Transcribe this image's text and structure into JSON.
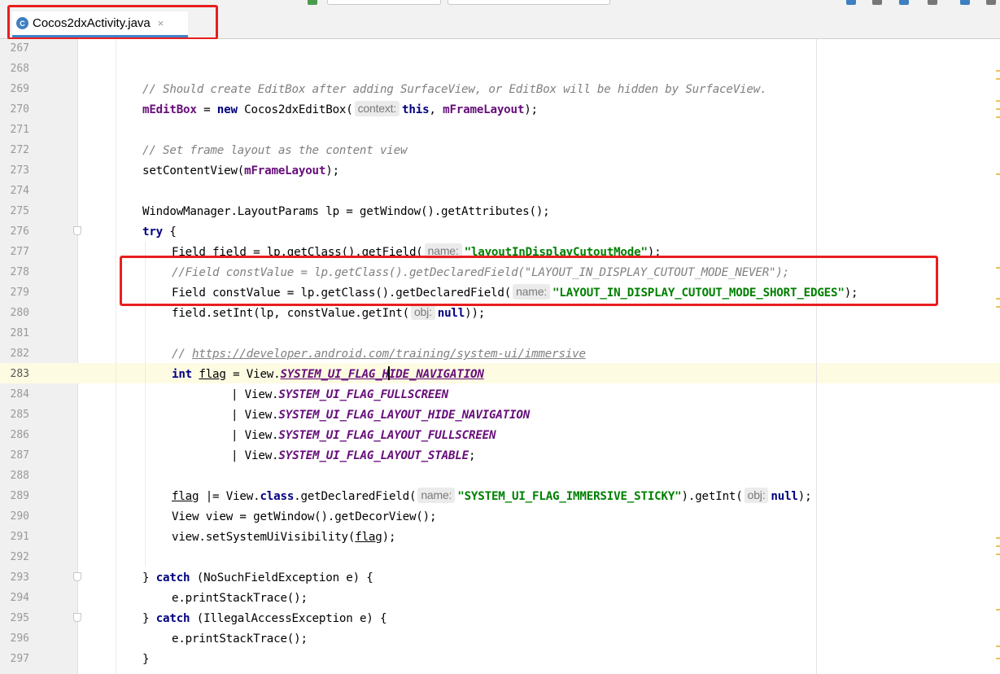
{
  "tab": {
    "label": "Cocos2dxActivity.java",
    "icon_letter": "C",
    "close_glyph": "×",
    "icon": "java-class-icon"
  },
  "hints": {
    "context": "context:",
    "name": "name:",
    "obj": "obj:"
  },
  "line_numbers": [
    "267",
    "268",
    "269",
    "270",
    "271",
    "272",
    "273",
    "274",
    "275",
    "276",
    "277",
    "278",
    "279",
    "280",
    "281",
    "282",
    "283",
    "284",
    "285",
    "286",
    "287",
    "288",
    "289",
    "290",
    "291",
    "292",
    "293",
    "294",
    "295",
    "296",
    "297"
  ],
  "code": {
    "l269_comment": "// Should create EditBox after adding SurfaceView, or EditBox will be hidden by SurfaceView.",
    "l270_var": "mEditBox",
    "l270_a": " = ",
    "l270_new": "new",
    "l270_b": " Cocos2dxEditBox(",
    "l270_this": "this",
    "l270_c": ", ",
    "l270_arg": "mFrameLayout",
    "l270_d": ");",
    "l272_comment": "// Set frame layout as the content view",
    "l273_a": "setContentView(",
    "l273_arg": "mFrameLayout",
    "l273_b": ");",
    "l275": "WindowManager.LayoutParams lp = getWindow().getAttributes();",
    "l276_try": "try",
    "l276_b": " {",
    "l277_a": "Field field = lp.getClass().getField(",
    "l277_str": "\"layoutInDisplayCutoutMode\"",
    "l277_b": ");",
    "l278_comment": "//Field constValue = lp.getClass().getDeclaredField(\"LAYOUT_IN_DISPLAY_CUTOUT_MODE_NEVER\");",
    "l279_a": "Field constValue = lp.getClass().getDeclaredField(",
    "l279_str": "\"LAYOUT_IN_DISPLAY_CUTOUT_MODE_SHORT_EDGES\"",
    "l279_b": ");",
    "l280_a": "field.setInt(lp, constValue.getInt(",
    "l280_null": "null",
    "l280_b": "));",
    "l282_comment": "// ",
    "l282_link": "https://developer.android.com/training/system-ui/immersive",
    "l283_int": "int",
    "l283_var": "flag",
    "l283_a": " = View.",
    "l283_fld_a": "SYSTEM_UI_FLAG_H",
    "l283_fld_b": "IDE_NAVIGATION",
    "l284_a": "| View.",
    "l284_fld": "SYSTEM_UI_FLAG_FULLSCREEN",
    "l285_a": "| View.",
    "l285_fld": "SYSTEM_UI_FLAG_LAYOUT_HIDE_NAVIGATION",
    "l286_a": "| View.",
    "l286_fld": "SYSTEM_UI_FLAG_LAYOUT_FULLSCREEN",
    "l287_a": "| View.",
    "l287_fld": "SYSTEM_UI_FLAG_LAYOUT_STABLE",
    "l287_b": ";",
    "l289_var": "flag",
    "l289_a": " |= View.",
    "l289_class": "class",
    "l289_b": ".getDeclaredField(",
    "l289_str": "\"SYSTEM_UI_FLAG_IMMERSIVE_STICKY\"",
    "l289_c": ").getInt(",
    "l289_null": "null",
    "l289_d": ");",
    "l290": "View view = getWindow().getDecorView();",
    "l291_a": "view.setSystemUiVisibility(",
    "l291_var": "flag",
    "l291_b": ");",
    "l293_a": "} ",
    "l293_catch": "catch",
    "l293_b": " (NoSuchFieldException e) {",
    "l294": "e.printStackTrace();",
    "l295_a": "} ",
    "l295_catch": "catch",
    "l295_b": " (IllegalAccessException e) {",
    "l296": "e.printStackTrace();",
    "l297": "}"
  },
  "colors": {
    "keyword": "#000080",
    "string": "#008000",
    "field": "#660e7a",
    "comment": "#808080",
    "annotation_box": "#e81e1e",
    "current_line": "#fdfce3"
  }
}
